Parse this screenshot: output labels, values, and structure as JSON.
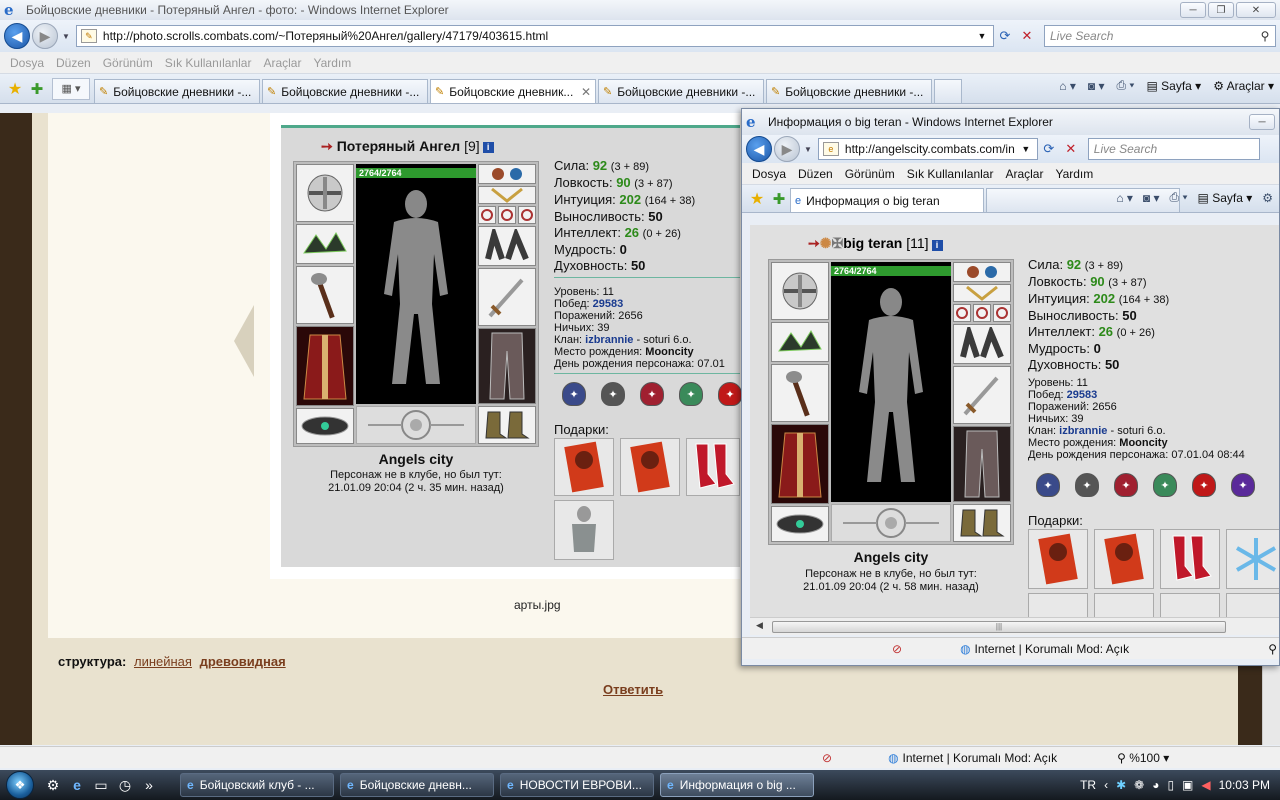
{
  "main": {
    "title": "Бойцовские дневники - Потеряный Ангел - фото: - Windows Internet Explorer",
    "url": "http://photo.scrolls.combats.com/~Потеряный%20Ангел/gallery/47179/403615.html",
    "search_placeholder": "Live Search",
    "menu": [
      "Dosya",
      "Düzen",
      "Görünüm",
      "Sık Kullanılanlar",
      "Araçlar",
      "Yardım"
    ],
    "tabs": [
      {
        "label": "Бойцовские дневники -..."
      },
      {
        "label": "Бойцовские дневники -..."
      },
      {
        "label": "Бойцовские дневник..."
      },
      {
        "label": "Бойцовские дневники -..."
      },
      {
        "label": "Бойцовские дневники -..."
      }
    ],
    "cmd": {
      "page": "Sayfa",
      "tools": "Araçlar"
    },
    "status_zone": "Internet | Korumalı Mod: Açık",
    "zoom": "%100",
    "caption": "арты.jpg",
    "structure_label": "структура:",
    "structure_linear": "линейная",
    "structure_tree": "древовидная",
    "reply": "Ответить"
  },
  "char1": {
    "name": "Потеряный Ангел",
    "level": "[9]",
    "hp": "2764/2764",
    "city": "Angels city",
    "status1": "Персонаж не в клубе, но был тут:",
    "status2": "21.01.09 20:04 (2 ч. 35 мин. назад)",
    "stats": [
      {
        "label": "Сила:",
        "value": "92",
        "extra": "(3 + 89)"
      },
      {
        "label": "Ловкость:",
        "value": "90",
        "extra": "(3 + 87)"
      },
      {
        "label": "Интуиция:",
        "value": "202",
        "extra": "(164 + 38)"
      },
      {
        "label": "Выносливость:",
        "value": "50",
        "extra": ""
      },
      {
        "label": "Интеллект:",
        "value": "26",
        "extra": "(0 + 26)"
      },
      {
        "label": "Мудрость:",
        "value": "0",
        "extra": ""
      },
      {
        "label": "Духовность:",
        "value": "50",
        "extra": ""
      }
    ],
    "level_line": "Уровень: 11",
    "wins_label": "Побед:",
    "wins": "29583",
    "losses": "Поражений: 2656",
    "draws": "Ничьих: 39",
    "clan_label": "Клан:",
    "clan": "izbrannie",
    "clan_rest": "- soturi 6.o.",
    "birthplace_label": "Место рождения:",
    "birthplace": "Mooncity",
    "birthday": "День рождения персонажа: 07.01",
    "gifts_label": "Подарки:"
  },
  "popup": {
    "title": "Информация о big teran - Windows Internet Explorer",
    "url": "http://angelscity.combats.com/in",
    "search_placeholder": "Live Search",
    "menu": [
      "Dosya",
      "Düzen",
      "Görünüm",
      "Sık Kullanılanlar",
      "Araçlar",
      "Yardım"
    ],
    "tab": "Информация о big teran",
    "cmd_page": "Sayfa",
    "status_zone": "Internet | Korumalı Mod: Açık",
    "name": "big teran",
    "level": "[11]",
    "hp": "2764/2764",
    "city": "Angels city",
    "status1": "Персонаж не в клубе, но был тут:",
    "status2": "21.01.09 20:04 (2 ч. 58 мин. назад)",
    "stats": [
      {
        "label": "Сила:",
        "value": "92",
        "extra": "(3 + 89)"
      },
      {
        "label": "Ловкость:",
        "value": "90",
        "extra": "(3 + 87)"
      },
      {
        "label": "Интуиция:",
        "value": "202",
        "extra": "(164 + 38)"
      },
      {
        "label": "Выносливость:",
        "value": "50",
        "extra": ""
      },
      {
        "label": "Интеллект:",
        "value": "26",
        "extra": "(0 + 26)"
      },
      {
        "label": "Мудрость:",
        "value": "0",
        "extra": ""
      },
      {
        "label": "Духовность:",
        "value": "50",
        "extra": ""
      }
    ],
    "level_line": "Уровень: 11",
    "wins_label": "Побед:",
    "wins": "29583",
    "losses": "Поражений: 2656",
    "draws": "Ничьих: 39",
    "clan_label": "Клан:",
    "clan": "izbrannie",
    "clan_rest": "- soturi 6.o.",
    "birthplace_label": "Место рождения:",
    "birthplace": "Mooncity",
    "birthday": "День рождения персонажа: 07.01.04 08:44",
    "gifts_label": "Подарки:"
  },
  "taskbar": {
    "items": [
      {
        "label": "Бойцовский клуб - ..."
      },
      {
        "label": "Бойцовские дневн..."
      },
      {
        "label": "НОВОСТИ ЕВРОВИ..."
      },
      {
        "label": "Информация о big ..."
      }
    ],
    "lang": "TR",
    "time": "10:03 PM"
  },
  "colors": {
    "stat_value": "#2d8a1a",
    "hp_bar": "#2e9a2e",
    "link": "#7a3e1e",
    "clan_blue": "#1a3b8f"
  }
}
